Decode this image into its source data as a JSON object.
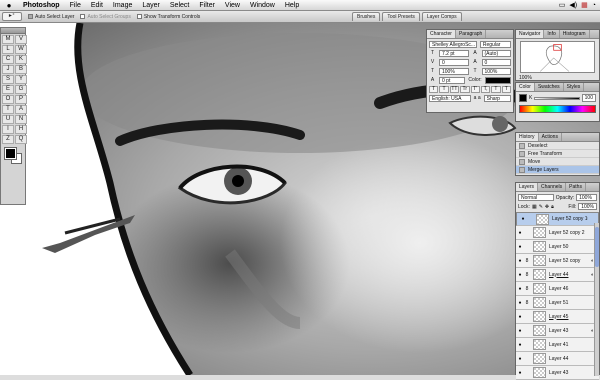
{
  "menubar": {
    "app": "Photoshop",
    "items": [
      "File",
      "Edit",
      "Image",
      "Layer",
      "Select",
      "Filter",
      "View",
      "Window",
      "Help"
    ],
    "tray_icons": [
      "display-icon",
      "sound-icon",
      "flag-icon",
      "clock-icon"
    ]
  },
  "options": {
    "auto_select": "Auto Select Layer",
    "auto_select_groups": "Auto Select Groups",
    "show_transform": "Show Transform Controls",
    "wells": [
      "Brushes",
      "Tool Presets",
      "Layer Comps"
    ]
  },
  "toolbox": {
    "tools": [
      "M",
      "V",
      "L",
      "W",
      "C",
      "K",
      "J",
      "B",
      "S",
      "Y",
      "E",
      "G",
      "O",
      "P",
      "T",
      "A",
      "U",
      "N",
      "I",
      "H",
      "Z",
      "Q"
    ]
  },
  "character": {
    "tabs": [
      "Character",
      "Paragraph"
    ],
    "font": "Shelley AllegroSc...",
    "style": "Regular",
    "size": "7.2 pt",
    "leading": "(Auto)",
    "tracking": "0",
    "kerning": "0",
    "vscale": "100%",
    "hscale": "100%",
    "baseline": "0 pt",
    "color_label": "Color:",
    "language": "English: USA",
    "aa_label": "a a",
    "aa": "Sharp",
    "format_buttons": [
      "T",
      "T",
      "TT",
      "Tr",
      "T'",
      "T,",
      "T",
      "T"
    ]
  },
  "navigator": {
    "tabs": [
      "Navigator",
      "Info",
      "Histogram"
    ],
    "zoom": "100%"
  },
  "color": {
    "tabs": [
      "Color",
      "Swatches",
      "Styles"
    ],
    "k_label": "K",
    "k_value": "100"
  },
  "history": {
    "tabs": [
      "History",
      "Actions"
    ],
    "items": [
      "Deselect",
      "Free Transform",
      "Move",
      "Merge Layers"
    ],
    "selected": 3
  },
  "layers": {
    "tabs": [
      "Layers",
      "Channels",
      "Paths"
    ],
    "mode": "Normal",
    "opacity_label": "Opacity:",
    "opacity": "100%",
    "lock_label": "Lock:",
    "fill_label": "Fill:",
    "fill": "100%",
    "rows": [
      {
        "name": "Layer 52 copy 10",
        "sel": true,
        "link": "",
        "fx": ""
      },
      {
        "name": "Layer 52 copy 2",
        "sel": false,
        "link": "",
        "fx": ""
      },
      {
        "name": "Layer 50",
        "sel": false,
        "link": "",
        "fx": ""
      },
      {
        "name": "Layer 52 copy",
        "sel": false,
        "link": "8",
        "fx": "◐"
      },
      {
        "name": "Layer 44",
        "sel": false,
        "link": "8",
        "fx": "◐",
        "ul": true
      },
      {
        "name": "Layer 46",
        "sel": false,
        "link": "8",
        "fx": ""
      },
      {
        "name": "Layer 51",
        "sel": false,
        "link": "8",
        "fx": ""
      },
      {
        "name": "Layer 45",
        "sel": false,
        "link": "",
        "fx": "",
        "ul": true
      },
      {
        "name": "Layer 43",
        "sel": false,
        "link": "",
        "fx": "◐"
      },
      {
        "name": "Layer 41",
        "sel": false,
        "link": "",
        "fx": ""
      },
      {
        "name": "Layer 44",
        "sel": false,
        "link": "",
        "fx": ""
      },
      {
        "name": "Layer 43",
        "sel": false,
        "link": "",
        "fx": ""
      }
    ]
  }
}
